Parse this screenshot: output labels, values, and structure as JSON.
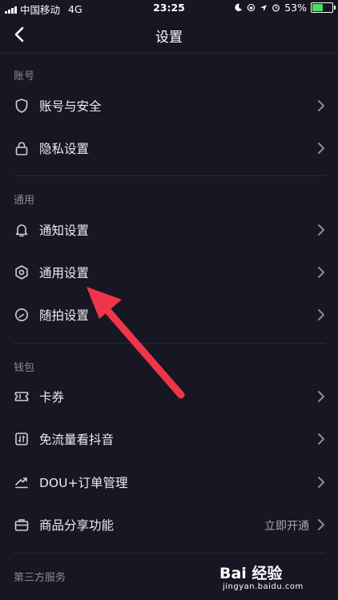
{
  "status_bar": {
    "carrier": "中国移动",
    "network": "4G",
    "time": "23:25",
    "battery_text": "53%",
    "battery_level": 0.53
  },
  "header": {
    "title": "设置"
  },
  "sections": [
    {
      "title": "账号",
      "items": [
        {
          "icon": "shield-icon",
          "label": "账号与安全"
        },
        {
          "icon": "lock-icon",
          "label": "隐私设置"
        }
      ]
    },
    {
      "title": "通用",
      "items": [
        {
          "icon": "bell-icon",
          "label": "通知设置"
        },
        {
          "icon": "gear-icon",
          "label": "通用设置"
        },
        {
          "icon": "camera-shutter-icon",
          "label": "随拍设置"
        }
      ]
    },
    {
      "title": "钱包",
      "items": [
        {
          "icon": "ticket-icon",
          "label": "卡券"
        },
        {
          "icon": "traffic-icon",
          "label": "免流量看抖音"
        },
        {
          "icon": "trend-icon",
          "label": "DOU+订单管理"
        },
        {
          "icon": "briefcase-icon",
          "label": "商品分享功能",
          "value": "立即开通"
        }
      ]
    },
    {
      "title": "第三方服务",
      "items": []
    }
  ],
  "watermark": {
    "brand": "Bai 经验",
    "domain": "jingyan.baidu.com"
  },
  "colors": {
    "background": "#161722",
    "annotation_arrow": "#f0354b",
    "secondary_text": "#8a8b96"
  }
}
